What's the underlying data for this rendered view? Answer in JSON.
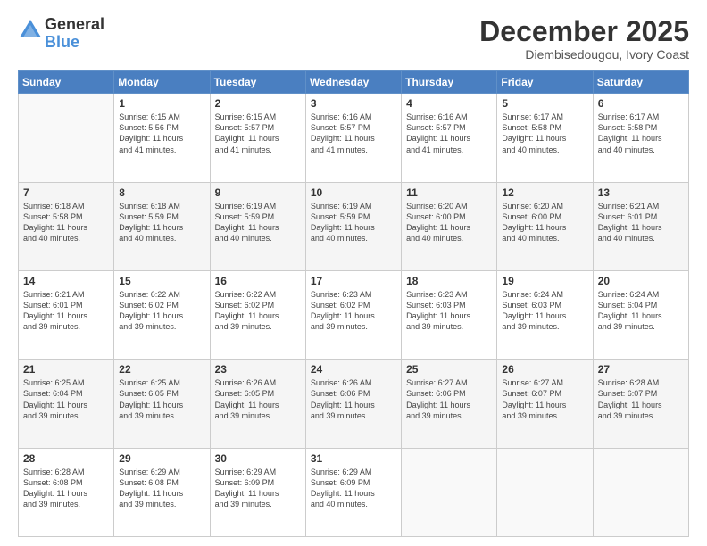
{
  "logo": {
    "general": "General",
    "blue": "Blue"
  },
  "header": {
    "month": "December 2025",
    "location": "Diembisedougou, Ivory Coast"
  },
  "days": [
    "Sunday",
    "Monday",
    "Tuesday",
    "Wednesday",
    "Thursday",
    "Friday",
    "Saturday"
  ],
  "weeks": [
    [
      {
        "day": "",
        "content": ""
      },
      {
        "day": "1",
        "content": "Sunrise: 6:15 AM\nSunset: 5:56 PM\nDaylight: 11 hours\nand 41 minutes."
      },
      {
        "day": "2",
        "content": "Sunrise: 6:15 AM\nSunset: 5:57 PM\nDaylight: 11 hours\nand 41 minutes."
      },
      {
        "day": "3",
        "content": "Sunrise: 6:16 AM\nSunset: 5:57 PM\nDaylight: 11 hours\nand 41 minutes."
      },
      {
        "day": "4",
        "content": "Sunrise: 6:16 AM\nSunset: 5:57 PM\nDaylight: 11 hours\nand 41 minutes."
      },
      {
        "day": "5",
        "content": "Sunrise: 6:17 AM\nSunset: 5:58 PM\nDaylight: 11 hours\nand 40 minutes."
      },
      {
        "day": "6",
        "content": "Sunrise: 6:17 AM\nSunset: 5:58 PM\nDaylight: 11 hours\nand 40 minutes."
      }
    ],
    [
      {
        "day": "7",
        "content": "Sunrise: 6:18 AM\nSunset: 5:58 PM\nDaylight: 11 hours\nand 40 minutes."
      },
      {
        "day": "8",
        "content": "Sunrise: 6:18 AM\nSunset: 5:59 PM\nDaylight: 11 hours\nand 40 minutes."
      },
      {
        "day": "9",
        "content": "Sunrise: 6:19 AM\nSunset: 5:59 PM\nDaylight: 11 hours\nand 40 minutes."
      },
      {
        "day": "10",
        "content": "Sunrise: 6:19 AM\nSunset: 5:59 PM\nDaylight: 11 hours\nand 40 minutes."
      },
      {
        "day": "11",
        "content": "Sunrise: 6:20 AM\nSunset: 6:00 PM\nDaylight: 11 hours\nand 40 minutes."
      },
      {
        "day": "12",
        "content": "Sunrise: 6:20 AM\nSunset: 6:00 PM\nDaylight: 11 hours\nand 40 minutes."
      },
      {
        "day": "13",
        "content": "Sunrise: 6:21 AM\nSunset: 6:01 PM\nDaylight: 11 hours\nand 40 minutes."
      }
    ],
    [
      {
        "day": "14",
        "content": "Sunrise: 6:21 AM\nSunset: 6:01 PM\nDaylight: 11 hours\nand 39 minutes."
      },
      {
        "day": "15",
        "content": "Sunrise: 6:22 AM\nSunset: 6:02 PM\nDaylight: 11 hours\nand 39 minutes."
      },
      {
        "day": "16",
        "content": "Sunrise: 6:22 AM\nSunset: 6:02 PM\nDaylight: 11 hours\nand 39 minutes."
      },
      {
        "day": "17",
        "content": "Sunrise: 6:23 AM\nSunset: 6:02 PM\nDaylight: 11 hours\nand 39 minutes."
      },
      {
        "day": "18",
        "content": "Sunrise: 6:23 AM\nSunset: 6:03 PM\nDaylight: 11 hours\nand 39 minutes."
      },
      {
        "day": "19",
        "content": "Sunrise: 6:24 AM\nSunset: 6:03 PM\nDaylight: 11 hours\nand 39 minutes."
      },
      {
        "day": "20",
        "content": "Sunrise: 6:24 AM\nSunset: 6:04 PM\nDaylight: 11 hours\nand 39 minutes."
      }
    ],
    [
      {
        "day": "21",
        "content": "Sunrise: 6:25 AM\nSunset: 6:04 PM\nDaylight: 11 hours\nand 39 minutes."
      },
      {
        "day": "22",
        "content": "Sunrise: 6:25 AM\nSunset: 6:05 PM\nDaylight: 11 hours\nand 39 minutes."
      },
      {
        "day": "23",
        "content": "Sunrise: 6:26 AM\nSunset: 6:05 PM\nDaylight: 11 hours\nand 39 minutes."
      },
      {
        "day": "24",
        "content": "Sunrise: 6:26 AM\nSunset: 6:06 PM\nDaylight: 11 hours\nand 39 minutes."
      },
      {
        "day": "25",
        "content": "Sunrise: 6:27 AM\nSunset: 6:06 PM\nDaylight: 11 hours\nand 39 minutes."
      },
      {
        "day": "26",
        "content": "Sunrise: 6:27 AM\nSunset: 6:07 PM\nDaylight: 11 hours\nand 39 minutes."
      },
      {
        "day": "27",
        "content": "Sunrise: 6:28 AM\nSunset: 6:07 PM\nDaylight: 11 hours\nand 39 minutes."
      }
    ],
    [
      {
        "day": "28",
        "content": "Sunrise: 6:28 AM\nSunset: 6:08 PM\nDaylight: 11 hours\nand 39 minutes."
      },
      {
        "day": "29",
        "content": "Sunrise: 6:29 AM\nSunset: 6:08 PM\nDaylight: 11 hours\nand 39 minutes."
      },
      {
        "day": "30",
        "content": "Sunrise: 6:29 AM\nSunset: 6:09 PM\nDaylight: 11 hours\nand 39 minutes."
      },
      {
        "day": "31",
        "content": "Sunrise: 6:29 AM\nSunset: 6:09 PM\nDaylight: 11 hours\nand 40 minutes."
      },
      {
        "day": "",
        "content": ""
      },
      {
        "day": "",
        "content": ""
      },
      {
        "day": "",
        "content": ""
      }
    ]
  ]
}
